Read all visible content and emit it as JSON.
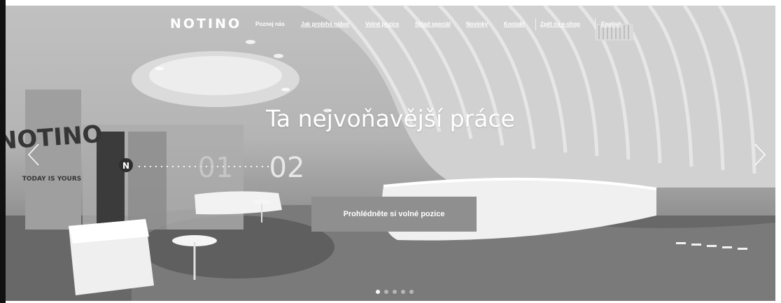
{
  "brand": {
    "logo": "NOTINO"
  },
  "nav": {
    "links": [
      {
        "label": "Poznej nás"
      },
      {
        "label": "Jak probíhá nábor"
      },
      {
        "label": "Volné pozice"
      },
      {
        "label": "Sklad speciál"
      },
      {
        "label": "Novinky"
      },
      {
        "label": "Kontakt"
      },
      {
        "label": "Zpět na e-shop"
      },
      {
        "label": "English"
      }
    ]
  },
  "hero": {
    "headline": "Ta nejvoňavější práce",
    "cta_label": "Prohlédněte si volné pozice",
    "wall_number_1": "01",
    "wall_number_2": "02",
    "wall_logo_letter": "N",
    "wall_sign": "NOTINO",
    "wall_tagline": "TODAY IS YOURS"
  },
  "carousel": {
    "slide_count": 5,
    "active_index": 0
  },
  "colors": {
    "cta_background": "#8f8f8f",
    "text": "#ffffff"
  }
}
